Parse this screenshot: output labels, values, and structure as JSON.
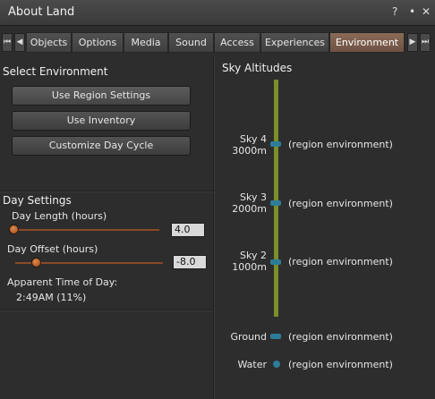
{
  "window": {
    "title": "About Land",
    "help": "?",
    "minimize": "•",
    "close": "✕"
  },
  "tabs": [
    {
      "label": "Objects"
    },
    {
      "label": "Options"
    },
    {
      "label": "Media"
    },
    {
      "label": "Sound"
    },
    {
      "label": "Access"
    },
    {
      "label": "Experiences"
    },
    {
      "label": "Environment",
      "active": true
    }
  ],
  "select_env": {
    "title": "Select Environment",
    "use_region": "Use Region Settings",
    "use_inventory": "Use Inventory",
    "customize": "Customize Day Cycle"
  },
  "day_settings": {
    "title": "Day Settings",
    "day_length_label": "Day Length (hours)",
    "day_length_value": "4.0",
    "day_offset_label": "Day Offset (hours)",
    "day_offset_value": "-8.0",
    "apparent_label": "Apparent Time of Day:",
    "apparent_value": "2:49AM (11%)"
  },
  "sky": {
    "title": "Sky Altitudes",
    "sky4_name": "Sky 4",
    "sky4_alt": "3000m",
    "sky4_env": "(region environment)",
    "sky3_name": "Sky 3",
    "sky3_alt": "2000m",
    "sky3_env": "(region environment)",
    "sky2_name": "Sky 2",
    "sky2_alt": "1000m",
    "sky2_env": "(region environment)",
    "ground_name": "Ground",
    "ground_env": "(region environment)",
    "water_name": "Water",
    "water_env": "(region environment)"
  },
  "colors": {
    "accent_tab": "#7a5c4c",
    "track": "#8a4a25",
    "altitude_bar": "#7a8f2a",
    "marker": "#2d7d9a"
  }
}
